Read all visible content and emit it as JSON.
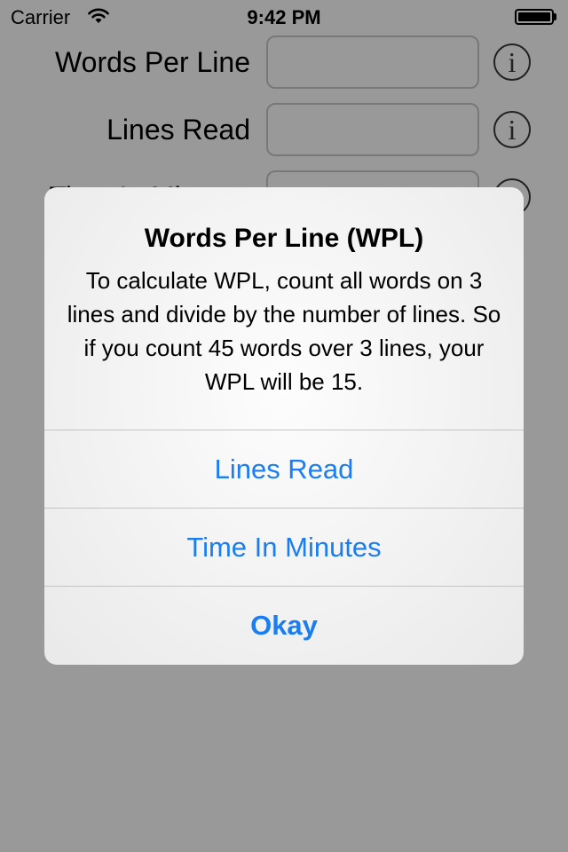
{
  "status_bar": {
    "carrier": "Carrier",
    "time": "9:42 PM",
    "wifi_icon": "wifi-icon",
    "battery_icon": "battery-full-icon"
  },
  "form": {
    "rows": [
      {
        "label": "Words Per Line",
        "value": "",
        "info_icon": "info-icon"
      },
      {
        "label": "Lines Read",
        "value": "",
        "info_icon": "info-icon"
      },
      {
        "label": "Time In Minutes",
        "value": "",
        "info_icon": "info-icon"
      }
    ]
  },
  "alert": {
    "title": "Words Per Line (WPL)",
    "message": "To calculate WPL, count all words on 3 lines and divide by the number of lines. So if you count 45 words over 3 lines, your WPL will be 15.",
    "buttons": [
      {
        "label": "Lines Read"
      },
      {
        "label": "Time In Minutes"
      },
      {
        "label": "Okay"
      }
    ]
  },
  "colors": {
    "accent": "#1a7df2",
    "overlay": "rgba(0,0,0,0.40)",
    "info_icon": "#3a3a3a"
  }
}
